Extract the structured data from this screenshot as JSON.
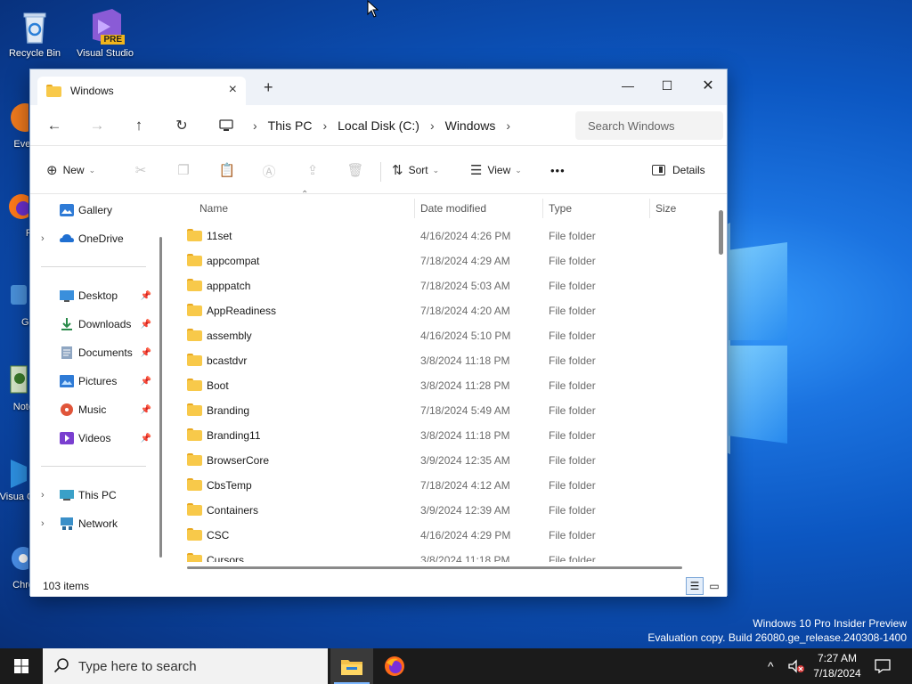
{
  "desktop": {
    "icons": [
      {
        "label": "Recycle Bin"
      },
      {
        "label": "Visual Studio",
        "badge": "PRE"
      },
      {
        "label": "Ever"
      },
      {
        "label": "Fi"
      },
      {
        "label": "Git"
      },
      {
        "label": "Note"
      },
      {
        "label": "Visua C"
      },
      {
        "label": "Chro"
      }
    ],
    "watermark": {
      "line1": "Windows 10 Pro Insider Preview",
      "line2": "Evaluation copy. Build 26080.ge_release.240308-1400"
    }
  },
  "window": {
    "tab_title": "Windows",
    "new_tab": "+",
    "controls": {
      "minimize": "—",
      "maximize": "☐",
      "close": "✕"
    }
  },
  "address": {
    "crumbs": [
      "This PC",
      "Local Disk (C:)",
      "Windows"
    ],
    "search_placeholder": "Search Windows"
  },
  "toolbar": {
    "new_label": "New",
    "sort_label": "Sort",
    "view_label": "View",
    "more_label": "•••",
    "details_label": "Details"
  },
  "nav": {
    "items": [
      {
        "label": "Gallery",
        "icon": "gallery-icon"
      },
      {
        "label": "OneDrive",
        "icon": "onedrive-icon"
      },
      {
        "label": "Desktop",
        "icon": "desktop-icon"
      },
      {
        "label": "Downloads",
        "icon": "downloads-icon"
      },
      {
        "label": "Documents",
        "icon": "documents-icon"
      },
      {
        "label": "Pictures",
        "icon": "pictures-icon"
      },
      {
        "label": "Music",
        "icon": "music-icon"
      },
      {
        "label": "Videos",
        "icon": "videos-icon"
      },
      {
        "label": "This PC",
        "icon": "this-pc-icon"
      },
      {
        "label": "Network",
        "icon": "network-icon"
      }
    ]
  },
  "files": {
    "columns": [
      "Name",
      "Date modified",
      "Type",
      "Size"
    ],
    "rows": [
      {
        "name": "11set",
        "date": "4/16/2024 4:26 PM",
        "type": "File folder"
      },
      {
        "name": "appcompat",
        "date": "7/18/2024 4:29 AM",
        "type": "File folder"
      },
      {
        "name": "apppatch",
        "date": "7/18/2024 5:03 AM",
        "type": "File folder"
      },
      {
        "name": "AppReadiness",
        "date": "7/18/2024 4:20 AM",
        "type": "File folder"
      },
      {
        "name": "assembly",
        "date": "4/16/2024 5:10 PM",
        "type": "File folder"
      },
      {
        "name": "bcastdvr",
        "date": "3/8/2024 11:18 PM",
        "type": "File folder"
      },
      {
        "name": "Boot",
        "date": "3/8/2024 11:28 PM",
        "type": "File folder"
      },
      {
        "name": "Branding",
        "date": "7/18/2024 5:49 AM",
        "type": "File folder"
      },
      {
        "name": "Branding11",
        "date": "3/8/2024 11:18 PM",
        "type": "File folder"
      },
      {
        "name": "BrowserCore",
        "date": "3/9/2024 12:35 AM",
        "type": "File folder"
      },
      {
        "name": "CbsTemp",
        "date": "7/18/2024 4:12 AM",
        "type": "File folder"
      },
      {
        "name": "Containers",
        "date": "3/9/2024 12:39 AM",
        "type": "File folder"
      },
      {
        "name": "CSC",
        "date": "4/16/2024 4:29 PM",
        "type": "File folder"
      },
      {
        "name": "Cursors",
        "date": "3/8/2024 11:18 PM",
        "type": "File folder"
      }
    ]
  },
  "status": {
    "item_count": "103 items"
  },
  "taskbar": {
    "search_placeholder": "Type here to search",
    "time": "7:27 AM",
    "date": "7/18/2024",
    "tray_chevron": "^"
  }
}
